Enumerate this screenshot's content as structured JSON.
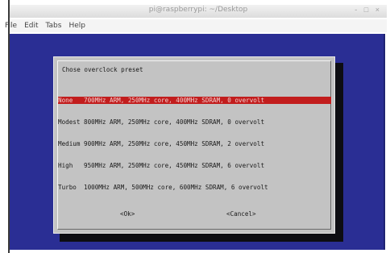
{
  "window": {
    "title": "pi@raspberrypi: ~/Desktop",
    "controls": "- □ ×"
  },
  "menu": {
    "items": [
      "File",
      "Edit",
      "Tabs",
      "Help"
    ]
  },
  "dialog": {
    "title": "Chose overclock preset",
    "presets": [
      {
        "label": "None   700MHz ARM, 250MHz core, 400MHz SDRAM, 0 overvolt",
        "selected": true
      },
      {
        "label": "Modest 800MHz ARM, 250MHz core, 400MHz SDRAM, 0 overvolt",
        "selected": false
      },
      {
        "label": "Medium 900MHz ARM, 250MHz core, 450MHz SDRAM, 2 overvolt",
        "selected": false
      },
      {
        "label": "High   950MHz ARM, 250MHz core, 450MHz SDRAM, 6 overvolt",
        "selected": false
      },
      {
        "label": "Turbo  1000MHz ARM, 500MHz core, 600MHz SDRAM, 6 overvolt",
        "selected": false
      }
    ],
    "ok_label": "<Ok>",
    "cancel_label": "<Cancel>"
  },
  "colors": {
    "terminal_bg": "#2a2e94",
    "dialog_bg": "#c3c3c3",
    "selection_bg": "#c21d1d"
  }
}
